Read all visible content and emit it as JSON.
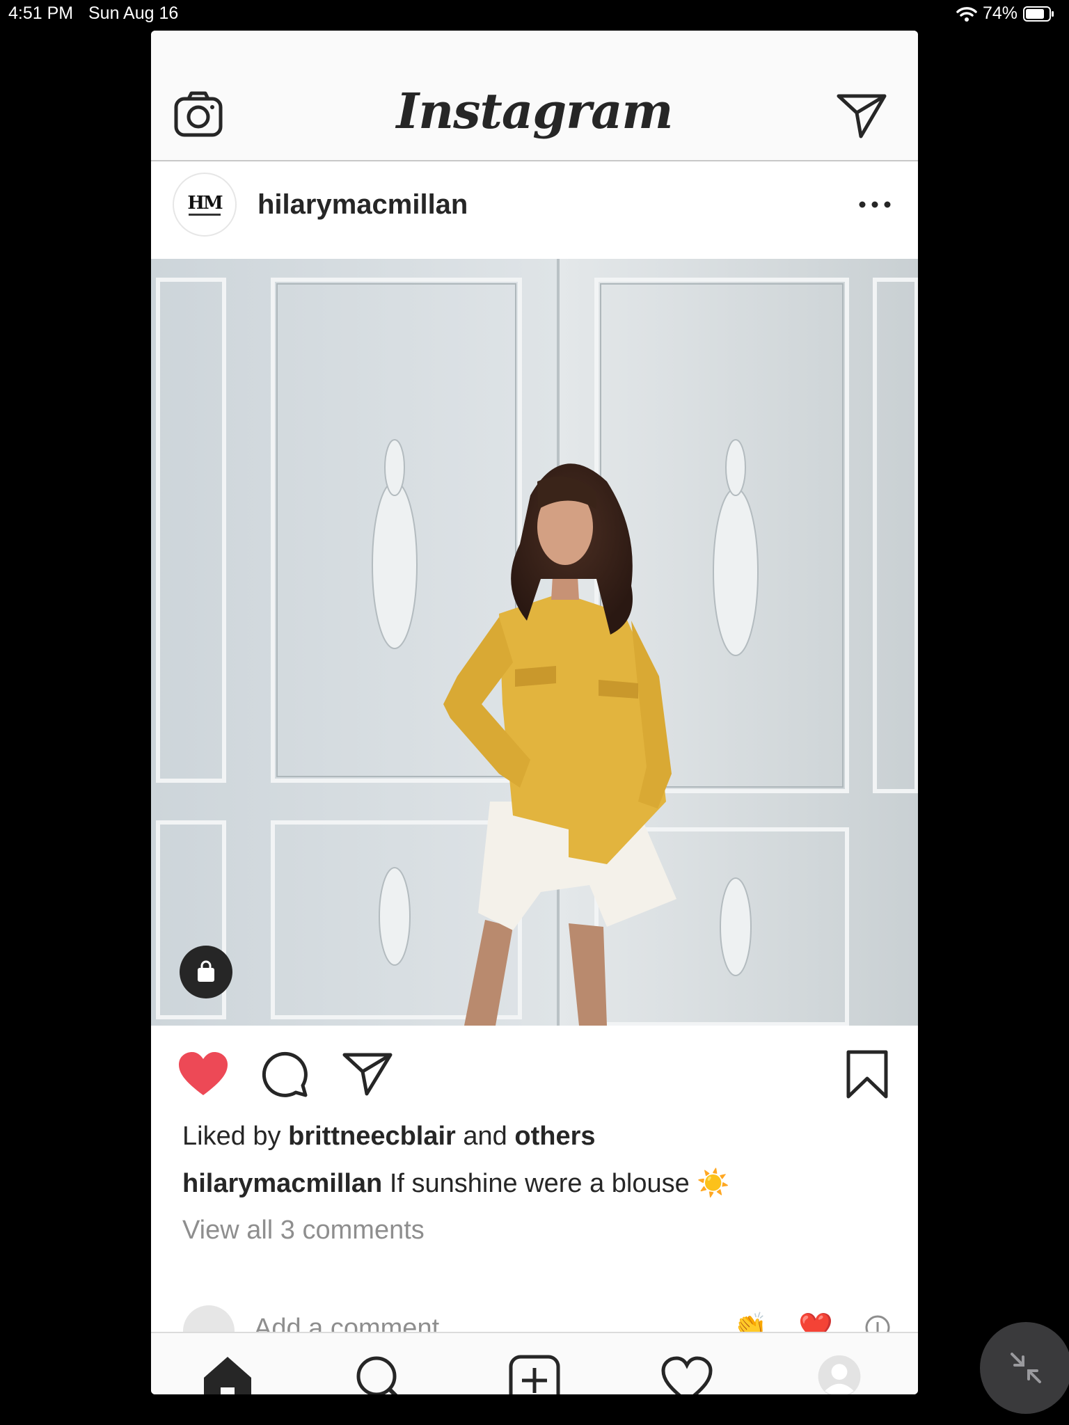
{
  "status_bar": {
    "time": "4:51 PM",
    "date": "Sun Aug 16",
    "battery": "74%"
  },
  "app": {
    "logo_text": "Instagram"
  },
  "post": {
    "username": "hilarymacmillan",
    "avatar_text": "HM",
    "likes": {
      "prefix": "Liked by",
      "user": "brittneecblair",
      "joiner": "and",
      "others": "others"
    },
    "caption": {
      "username": "hilarymacmillan",
      "text": "If sunshine were a blouse ☀️"
    },
    "view_comments": "View all 3 comments",
    "add_comment_placeholder": "Add a comment...",
    "quick_reactions": [
      "👏",
      "❤️"
    ],
    "liked": true
  },
  "colors": {
    "like_red": "#ed4956",
    "text": "#262626",
    "muted": "#8e8e8e",
    "blouse": "#e2b43e"
  },
  "icons": {
    "camera": "camera-icon",
    "direct": "paper-plane-icon",
    "more": "ellipsis-icon",
    "shop": "shopping-bag-icon",
    "like": "heart-filled-icon",
    "comment": "speech-bubble-icon",
    "share": "paper-plane-icon",
    "save": "bookmark-icon",
    "home": "home-icon",
    "search": "search-icon",
    "new_post": "plus-square-icon",
    "activity": "heart-outline-icon",
    "profile": "profile-avatar-icon",
    "pip": "minimize-arrows-icon"
  }
}
